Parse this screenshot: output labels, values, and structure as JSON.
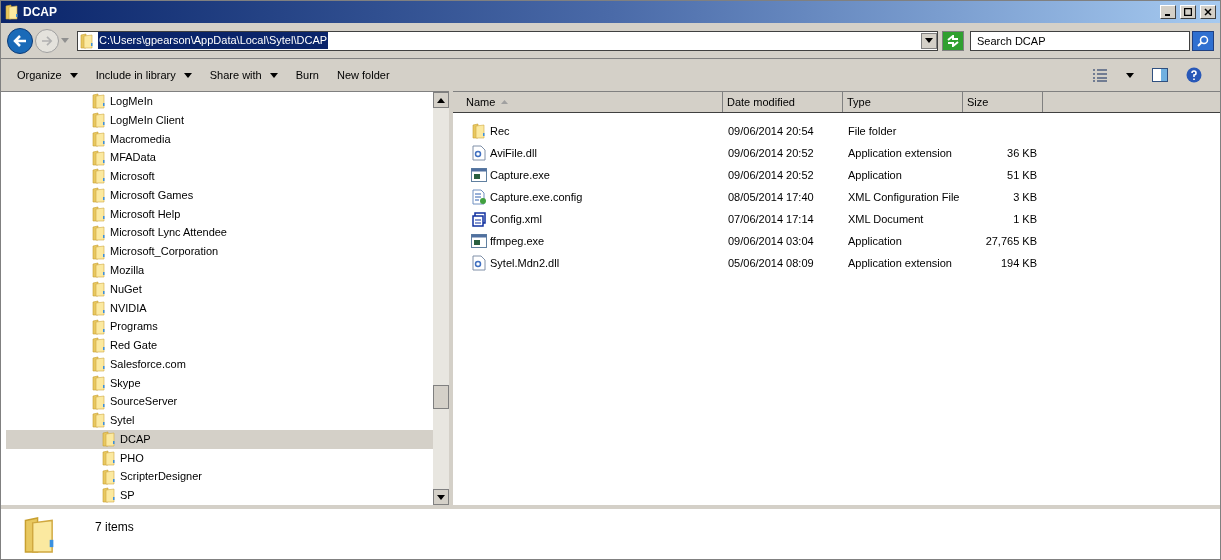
{
  "window": {
    "title": "DCAP"
  },
  "address": {
    "path": "C:\\Users\\gpearson\\AppData\\Local\\Sytel\\DCAP"
  },
  "search": {
    "placeholder": "Search DCAP"
  },
  "toolbar": [
    {
      "label": "Organize",
      "dropdown": true
    },
    {
      "label": "Include in library",
      "dropdown": true
    },
    {
      "label": "Share with",
      "dropdown": true
    },
    {
      "label": "Burn",
      "dropdown": false
    },
    {
      "label": "New folder",
      "dropdown": false
    }
  ],
  "tree": [
    {
      "label": "LogMeIn",
      "selected": false
    },
    {
      "label": "LogMeIn Client",
      "selected": false
    },
    {
      "label": "Macromedia",
      "selected": false
    },
    {
      "label": "MFAData",
      "selected": false
    },
    {
      "label": "Microsoft",
      "selected": false
    },
    {
      "label": "Microsoft Games",
      "selected": false
    },
    {
      "label": "Microsoft Help",
      "selected": false
    },
    {
      "label": "Microsoft Lync Attendee",
      "selected": false
    },
    {
      "label": "Microsoft_Corporation",
      "selected": false
    },
    {
      "label": "Mozilla",
      "selected": false
    },
    {
      "label": "NuGet",
      "selected": false
    },
    {
      "label": "NVIDIA",
      "selected": false
    },
    {
      "label": "Programs",
      "selected": false
    },
    {
      "label": "Red Gate",
      "selected": false
    },
    {
      "label": "Salesforce.com",
      "selected": false
    },
    {
      "label": "Skype",
      "selected": false
    },
    {
      "label": "SourceServer",
      "selected": false
    },
    {
      "label": "Sytel",
      "selected": false,
      "children": [
        {
          "label": "DCAP",
          "selected": true
        },
        {
          "label": "PHO",
          "selected": false
        },
        {
          "label": "ScripterDesigner",
          "selected": false
        },
        {
          "label": "SP",
          "selected": false
        }
      ]
    }
  ],
  "table": {
    "columns": [
      {
        "label": "Name",
        "sorted": true
      },
      {
        "label": "Date modified",
        "sorted": false
      },
      {
        "label": "Type",
        "sorted": false
      },
      {
        "label": "Size",
        "sorted": false
      }
    ],
    "rows": [
      {
        "kind": "folder",
        "name": "Rec",
        "date": "09/06/2014 20:54",
        "type": "File folder"
      },
      {
        "kind": "dll",
        "name": "AviFile.dll",
        "date": "09/06/2014 20:52",
        "type": "Application extension",
        "size": "36 KB"
      },
      {
        "kind": "exe",
        "name": "Capture.exe",
        "date": "09/06/2014 20:52",
        "type": "Application",
        "size": "51 KB"
      },
      {
        "kind": "config",
        "name": "Capture.exe.config",
        "date": "08/05/2014 17:40",
        "type": "XML Configuration File",
        "size": "3 KB"
      },
      {
        "kind": "xml",
        "name": "Config.xml",
        "date": "07/06/2014 17:14",
        "type": "XML Document",
        "size": "1 KB"
      },
      {
        "kind": "exe",
        "name": "ffmpeg.exe",
        "date": "09/06/2014 03:04",
        "type": "Application",
        "size": "27,765 KB"
      },
      {
        "kind": "dll",
        "name": "Sytel.Mdn2.dll",
        "date": "05/06/2014 08:09",
        "type": "Application extension",
        "size": "194 KB"
      }
    ]
  },
  "status_bar": {
    "count": "7 items"
  }
}
